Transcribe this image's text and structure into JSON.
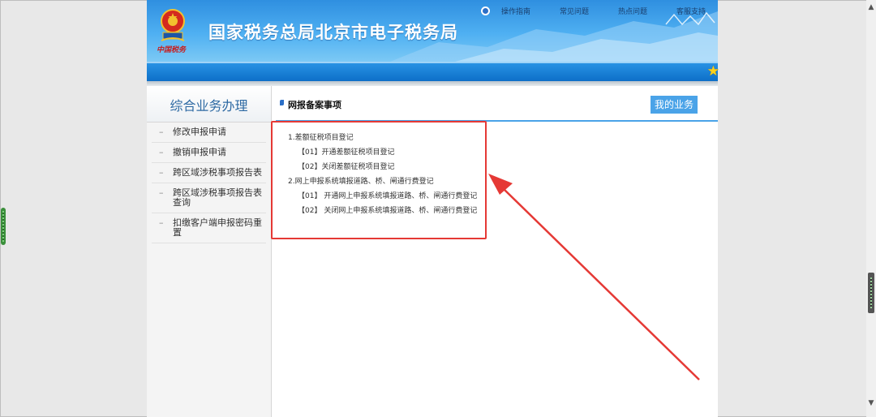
{
  "header": {
    "site_title": "国家税务总局北京市电子税务局",
    "emblem_caption": "中国税务",
    "top_links": [
      "操作指南",
      "常见问题",
      "热点问题",
      "客服支持"
    ]
  },
  "sidebar": {
    "title": "综合业务办理",
    "items": [
      "修改申报申请",
      "撤销申报申请",
      "跨区域涉税事项报告表",
      "跨区域涉税事项报告表查询",
      "扣缴客户端申报密码重置"
    ]
  },
  "content": {
    "title": "网报备案事项",
    "my_business_label": "我的业务",
    "sections": [
      {
        "heading": "1.差额征税项目登记",
        "items": [
          "【01】开通差额征税项目登记",
          "【02】关闭差额征税项目登记"
        ]
      },
      {
        "heading": "2.网上申报系统填报道路、桥、闸通行费登记",
        "items": [
          "【01】 开通网上申报系统填报道路、桥、闸通行费登记",
          "【02】 关闭网上申报系统填报道路、桥、闸通行费登记"
        ]
      }
    ]
  },
  "colors": {
    "brand_blue": "#0d6fc8",
    "accent_blue": "#4aa3e8",
    "annotation_red": "#e53935"
  },
  "icons": [
    "emblem-icon",
    "bullet-icon",
    "star-icon",
    "header-icon",
    "scroll-up-icon",
    "scroll-down-icon"
  ]
}
